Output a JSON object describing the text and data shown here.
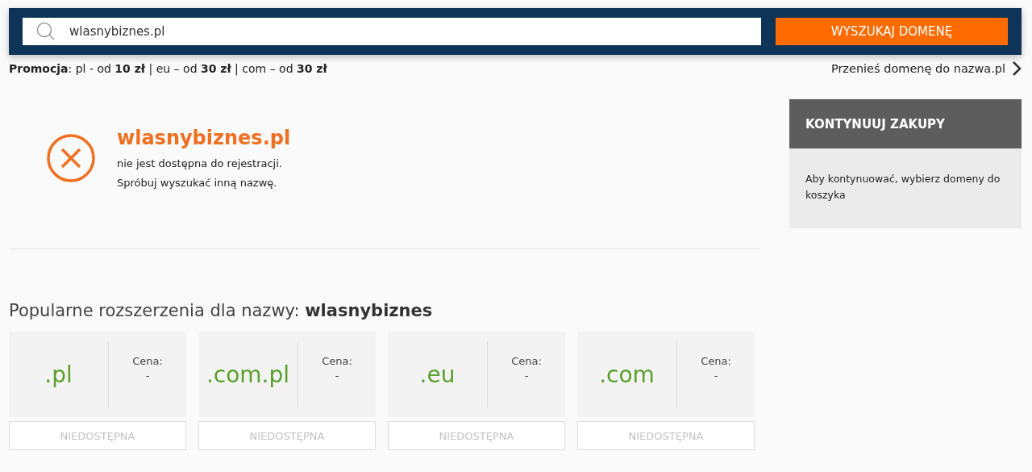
{
  "search": {
    "value": "wlasnybiznes.pl",
    "button": "WYSZUKAJ DOMENĘ"
  },
  "promo": "**Promocja**: pl - od **10 zł** | eu – od **30 zł** | com – od **30 zł**",
  "transfer_link": "Przenieś domenę do nazwa.pl",
  "result": {
    "domain": "wlasnybiznes.pl",
    "available": false,
    "lines": [
      "nie jest dostępna do rejestracji.",
      "Spróbuj wyszukać inną nazwę."
    ]
  },
  "cart": {
    "title": "KONTYNUUJ ZAKUPY",
    "message": "Aby kontynuować, wybierz domeny do koszyka"
  },
  "extensions_heading": "Popularne rozszerzenia dla nazwy: **wlasnybiznes**",
  "extensions": [
    {
      "tld": ".pl",
      "price_label": "Cena:",
      "price": "-",
      "button": "NIEDOSTĘPNA",
      "available": false
    },
    {
      "tld": ".com.pl",
      "price_label": "Cena:",
      "price": "-",
      "button": "NIEDOSTĘPNA",
      "available": false
    },
    {
      "tld": ".eu",
      "price_label": "Cena:",
      "price": "-",
      "button": "NIEDOSTĘPNA",
      "available": false
    },
    {
      "tld": ".com",
      "price_label": "Cena:",
      "price": "-",
      "button": "NIEDOSTĘPNA",
      "available": false
    }
  ]
}
